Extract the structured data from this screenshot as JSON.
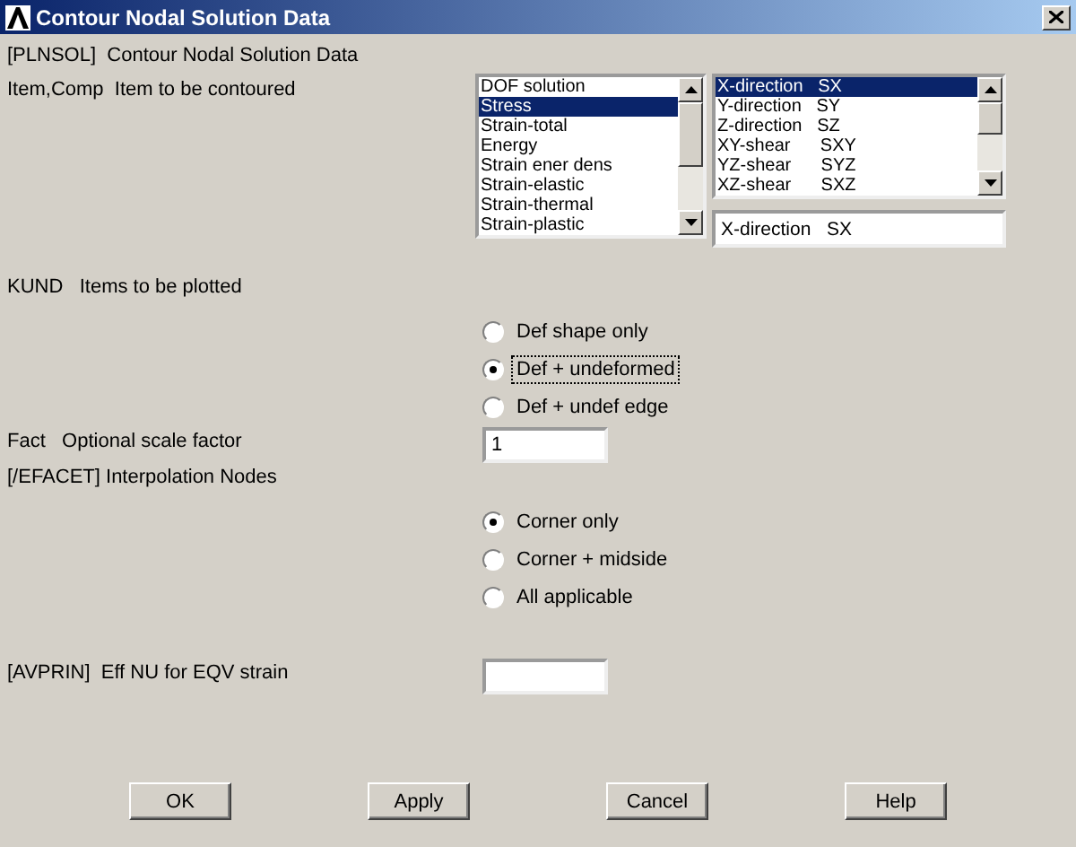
{
  "window": {
    "title": "Contour Nodal Solution Data"
  },
  "header": "[PLNSOL]  Contour Nodal Solution Data",
  "item_comp": {
    "label": "Item,Comp  Item to be contoured",
    "items": [
      {
        "label": "DOF solution",
        "selected": false
      },
      {
        "label": "Stress",
        "selected": true
      },
      {
        "label": "Strain-total",
        "selected": false
      },
      {
        "label": "Energy",
        "selected": false
      },
      {
        "label": "Strain ener dens",
        "selected": false
      },
      {
        "label": "Strain-elastic",
        "selected": false
      },
      {
        "label": "Strain-thermal",
        "selected": false
      },
      {
        "label": "Strain-plastic",
        "selected": false
      }
    ],
    "components": [
      {
        "label": "X-direction   SX",
        "selected": true
      },
      {
        "label": "Y-direction   SY",
        "selected": false
      },
      {
        "label": "Z-direction   SZ",
        "selected": false
      },
      {
        "label": "XY-shear      SXY",
        "selected": false
      },
      {
        "label": "YZ-shear      SYZ",
        "selected": false
      },
      {
        "label": "XZ-shear      SXZ",
        "selected": false
      }
    ],
    "value": "X-direction   SX"
  },
  "kund": {
    "label": "KUND   Items to be plotted",
    "options": [
      {
        "label": "Def shape only",
        "selected": false,
        "focused": false
      },
      {
        "label": "Def + undeformed",
        "selected": true,
        "focused": true
      },
      {
        "label": "Def + undef edge",
        "selected": false,
        "focused": false
      }
    ]
  },
  "fact": {
    "label": "Fact   Optional scale factor",
    "value": "1"
  },
  "efacet": {
    "label": "[/EFACET] Interpolation Nodes",
    "options": [
      {
        "label": "Corner only",
        "selected": true,
        "focused": false
      },
      {
        "label": "Corner + midside",
        "selected": false,
        "focused": false
      },
      {
        "label": "All applicable",
        "selected": false,
        "focused": false
      }
    ]
  },
  "avprin": {
    "label": "[AVPRIN]  Eff NU for EQV strain"
  },
  "buttons": [
    "OK",
    "Apply",
    "Cancel",
    "Help"
  ]
}
